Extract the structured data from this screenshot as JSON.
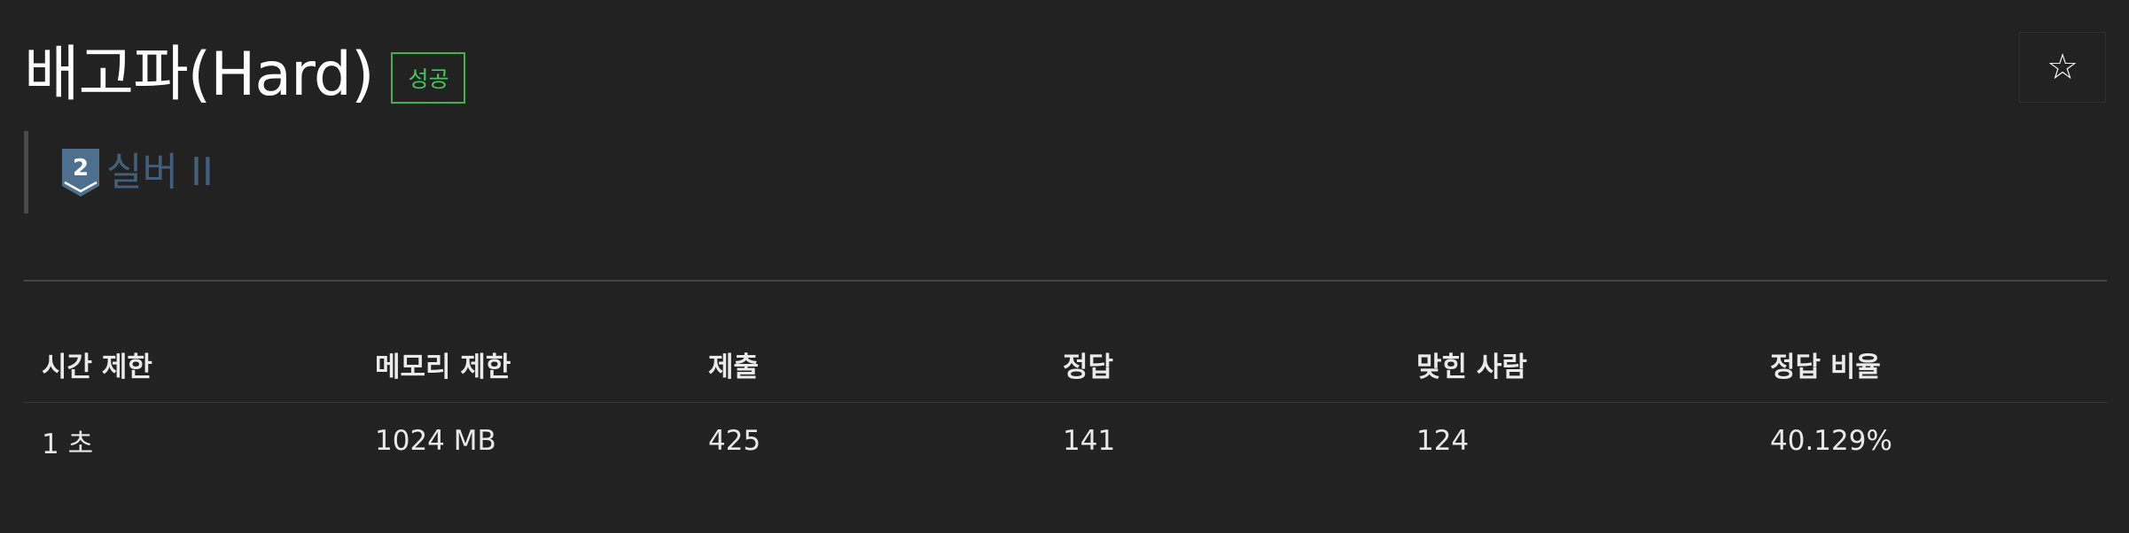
{
  "problem": {
    "title": "배고파(Hard)",
    "result_badge": "성공",
    "star_icon": "☆"
  },
  "tier": {
    "icon": "silver-tier-icon",
    "icon_number": "2",
    "label": "실버 II",
    "color": "#435f7a"
  },
  "stats": {
    "headers": [
      "시간 제한",
      "메모리 제한",
      "제출",
      "정답",
      "맞힌 사람",
      "정답 비율"
    ],
    "values": [
      "1 초",
      "1024 MB",
      "425",
      "141",
      "124",
      "40.129%"
    ]
  },
  "colors": {
    "background": "#222222",
    "success": "#47c75a",
    "divider": "#444444"
  }
}
